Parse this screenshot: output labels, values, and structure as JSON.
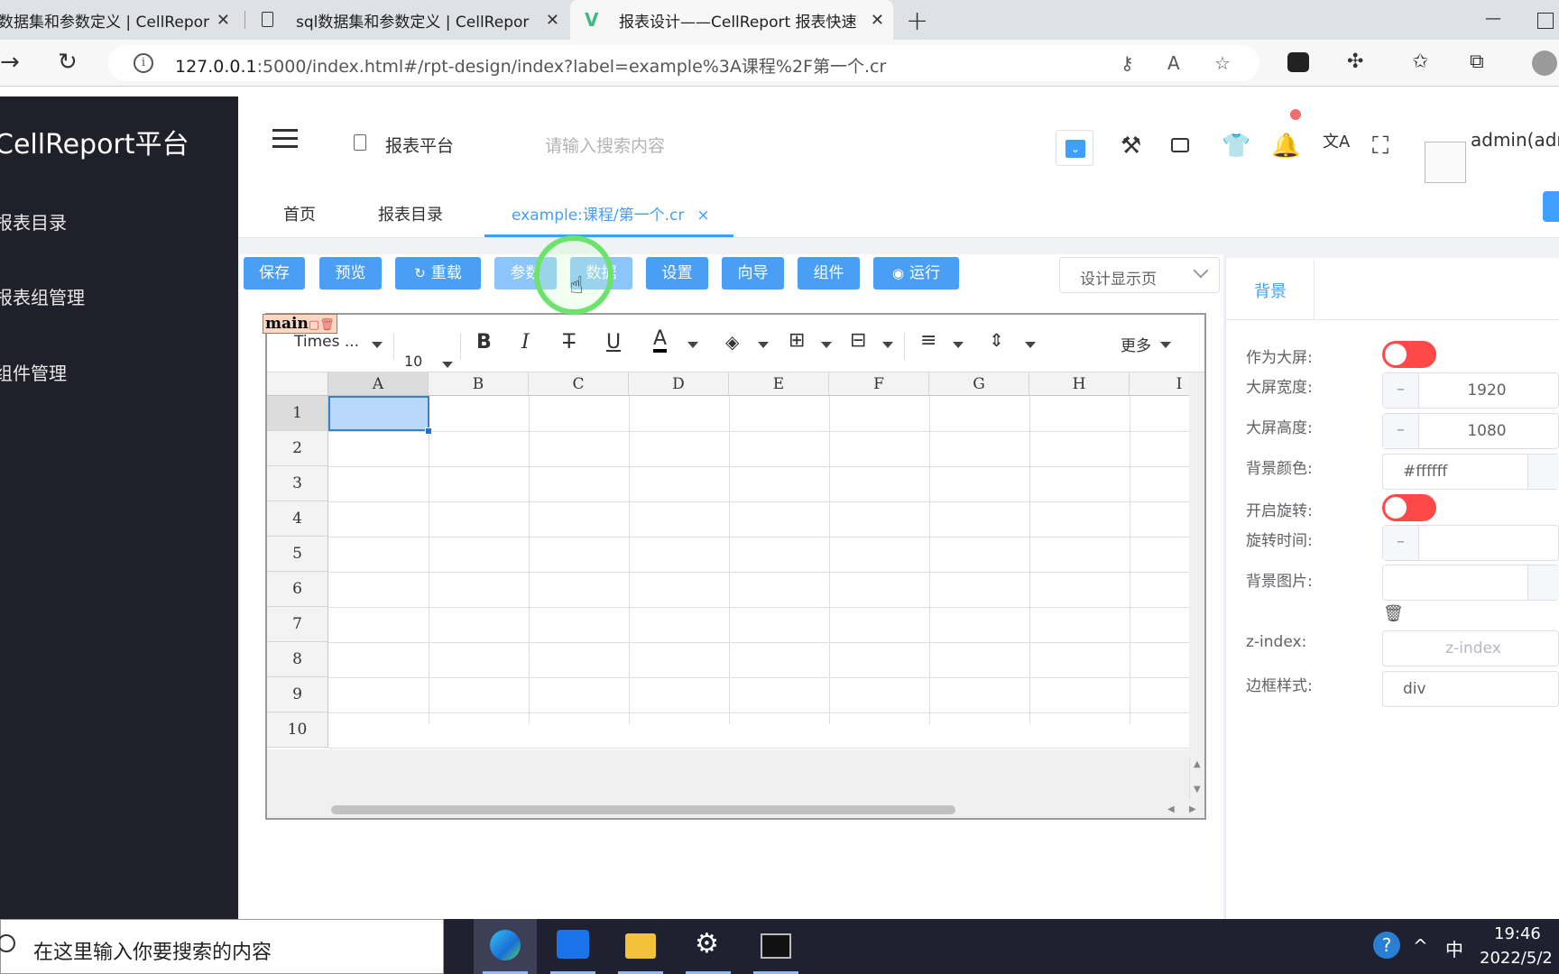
{
  "browser": {
    "tabs": [
      {
        "title": "数据集和参数定义 | CellRepor",
        "close": "✕"
      },
      {
        "title": "sql数据集和参数定义 | CellRepor",
        "close": "✕"
      },
      {
        "title": "报表设计——CellReport 报表快速",
        "close": "✕"
      }
    ],
    "new_tab": "+",
    "url_host": "127.0.0.1",
    "url_rest": ":5000/index.html#/rpt-design/index?label=example%3A课程%2F第一个.cr"
  },
  "sidebar": {
    "brand": "CellReport平台",
    "items": [
      {
        "label": "报表目录"
      },
      {
        "label": "报表组管理"
      },
      {
        "label": "组件管理"
      }
    ]
  },
  "header": {
    "app_title": "报表平台",
    "search_placeholder": "请输入搜索内容",
    "user_name": "admin(adm"
  },
  "page_tabs": {
    "home": "首页",
    "catalog": "报表目录",
    "active_file": "example:课程/第一个.cr",
    "close": "×"
  },
  "toolbar": {
    "save": "保存",
    "preview": "预览",
    "reload": "重载",
    "params": "参数",
    "data": "数据",
    "settings": "设置",
    "wizard": "向导",
    "components": "组件",
    "run": "运行",
    "display_select": "设计显示页"
  },
  "sheet": {
    "name": "main",
    "font_family": "Times ...",
    "font_size": "10",
    "more": "更多",
    "columns": [
      "A",
      "B",
      "C",
      "D",
      "E",
      "F",
      "G",
      "H",
      "I"
    ],
    "rows": [
      "1",
      "2",
      "3",
      "4",
      "5",
      "6",
      "7",
      "8",
      "9",
      "10"
    ]
  },
  "props": {
    "tab": "背景",
    "big_screen_label": "作为大屏:",
    "width_label": "大屏宽度:",
    "width_value": "1920",
    "height_label": "大屏高度:",
    "height_value": "1080",
    "bg_color_label": "背景颜色:",
    "bg_color_value": "#ffffff",
    "rotate_label": "开启旋转:",
    "rotate_time_label": "旋转时间:",
    "bg_image_label": "背景图片:",
    "zindex_label": "z-index:",
    "zindex_placeholder": "z-index",
    "border_label": "边框样式:",
    "border_value": "div",
    "minus": "–"
  },
  "taskbar": {
    "search_placeholder": "在这里输入你要搜索的内容",
    "ime": "中",
    "time": "19:46",
    "date": "2022/5/2"
  },
  "colors": {
    "accent": "#409eff",
    "sidebar_bg": "#1f2029",
    "switch_off": "#ff4949"
  }
}
